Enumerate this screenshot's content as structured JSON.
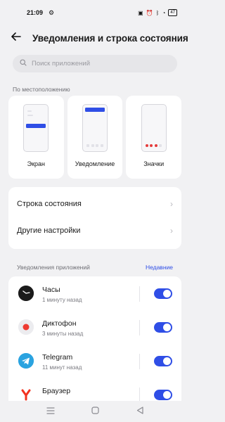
{
  "status": {
    "time": "21:09",
    "battery": "47"
  },
  "header": {
    "title": "Уведомления и строка состояния"
  },
  "search": {
    "placeholder": "Поиск приложений"
  },
  "location": {
    "label": "По местоположению",
    "options": [
      {
        "label": "Экран"
      },
      {
        "label": "Уведомление"
      },
      {
        "label": "Значки"
      }
    ]
  },
  "settings": [
    {
      "label": "Строка состояния"
    },
    {
      "label": "Другие настройки"
    }
  ],
  "apps_section": {
    "label": "Уведомления приложений",
    "sort": "Недавние"
  },
  "apps": [
    {
      "name": "Часы",
      "time": "1 минуту назад",
      "icon": "clock-icon",
      "enabled": true
    },
    {
      "name": "Диктофон",
      "time": "3 минуты назад",
      "icon": "recorder-icon",
      "enabled": true
    },
    {
      "name": "Telegram",
      "time": "11 минут назад",
      "icon": "telegram-icon",
      "enabled": true
    },
    {
      "name": "Браузер",
      "time": "",
      "icon": "browser-icon",
      "enabled": true
    }
  ],
  "colors": {
    "accent": "#2f4ee6",
    "background": "#f1f1f3"
  }
}
